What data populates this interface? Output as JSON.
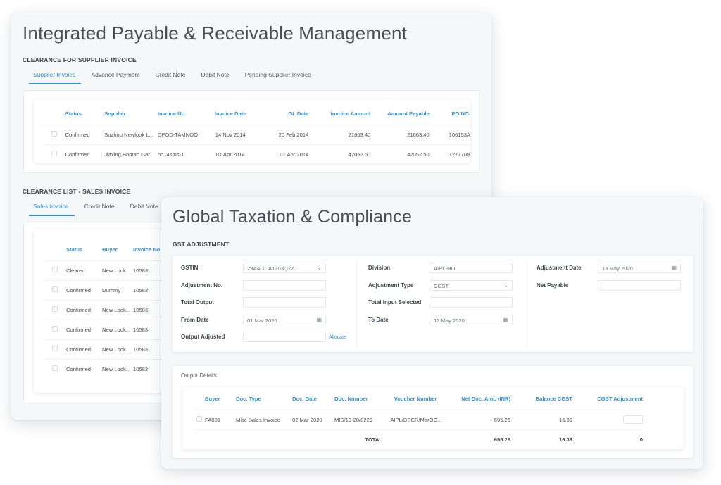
{
  "payable": {
    "title": "Integrated Payable & Receivable Management",
    "supplier_section": "CLEARANCE FOR SUPPLIER INVOICE",
    "supplier_tabs": [
      "Supplier Invoice",
      "Advance Payment",
      "Credit Note",
      "Debit Note",
      "Pending Supplier Invoice"
    ],
    "supplier_headers": [
      "Status",
      "Supplier",
      "Invoice No.",
      "Invoice Date",
      "GL Date",
      "Invoice Amount",
      "Amount Payable",
      "PO NO."
    ],
    "supplier_rows": [
      [
        "Confirmed",
        "Suzhou Newlook L...",
        "DPOD-TAMNOO",
        "14 Nov 2014",
        "20 Feb 2014",
        "21663.40",
        "21663.40",
        "106153A"
      ],
      [
        "Confirmed",
        "Jiaxing Bomao Gar..",
        "ho14sms-1",
        "01 Apr 2014",
        "01 Apr 2014",
        "42052.50",
        "42052.50",
        "127770B"
      ]
    ],
    "sales_section": "CLEARANCE LIST - SALES INVOICE",
    "sales_tabs": [
      "Sales Invoice",
      "Credit Note",
      "Debit Note"
    ],
    "sales_headers": [
      "Status",
      "Buyer",
      "Invoice No"
    ],
    "sales_rows": [
      [
        "Cleared",
        "New Look...",
        "10583"
      ],
      [
        "Confirmed",
        "Dummy",
        "10583"
      ],
      [
        "Confirmed",
        "New Look...",
        "10583"
      ],
      [
        "Confirmed",
        "New Look...",
        "10583"
      ],
      [
        "Confirmed",
        "New Look...",
        "10583"
      ],
      [
        "Confirmed",
        "New Look...",
        "10583"
      ]
    ]
  },
  "tax": {
    "title": "Global Taxation & Compliance",
    "gst_section": "GST ADJUSTMENT",
    "labels": {
      "gstin": "GSTIN",
      "adjustment_no": "Adjustment No.",
      "total_output": "Total Output",
      "from_date": "From Date",
      "output_adjusted": "Output Adjusted",
      "division": "Division",
      "adjustment_type": "Adjustment Type",
      "total_input_selected": "Total Input Selected",
      "to_date": "To Date",
      "adjustment_date": "Adjustment Date",
      "net_payable": "Net Payable"
    },
    "values": {
      "gstin": "29AAGCA1203Q2ZJ",
      "adjustment_no": "",
      "total_output": "",
      "from_date": "01 Mar 2020",
      "output_adjusted": "",
      "division": "AIPL-HO",
      "adjustment_type": "CGST",
      "total_input_selected": "",
      "to_date": "13 May 2020",
      "adjustment_date": "13 May 2020",
      "net_payable": ""
    },
    "allocate_link": "Allocate",
    "output_details": {
      "title": "Output Details",
      "headers": [
        "Buyer",
        "Doc. Type",
        "Doc. Date",
        "Doc. Number",
        "Voucher Number",
        "Net Doc. Amt. (INR)",
        "Balance CGST",
        "CGST Adjustment"
      ],
      "row": [
        "FA001",
        "Misc Sales Invoice",
        "02 Mar 2020",
        "MIS/19-20/0229",
        "AIPL/DSCR/MarOO..",
        "695.26",
        "16.39"
      ],
      "total_label": "TOTAL",
      "total_amount": "695.26",
      "total_balance": "16.39",
      "total_adjustment": "0"
    }
  },
  "icons": {
    "dropdown": "chevron-down-icon",
    "calendar": "calendar-icon"
  },
  "colors": {
    "accent": "#2f8fd1",
    "card_bg": "#f6f7f9",
    "text": "#4a4f57"
  }
}
